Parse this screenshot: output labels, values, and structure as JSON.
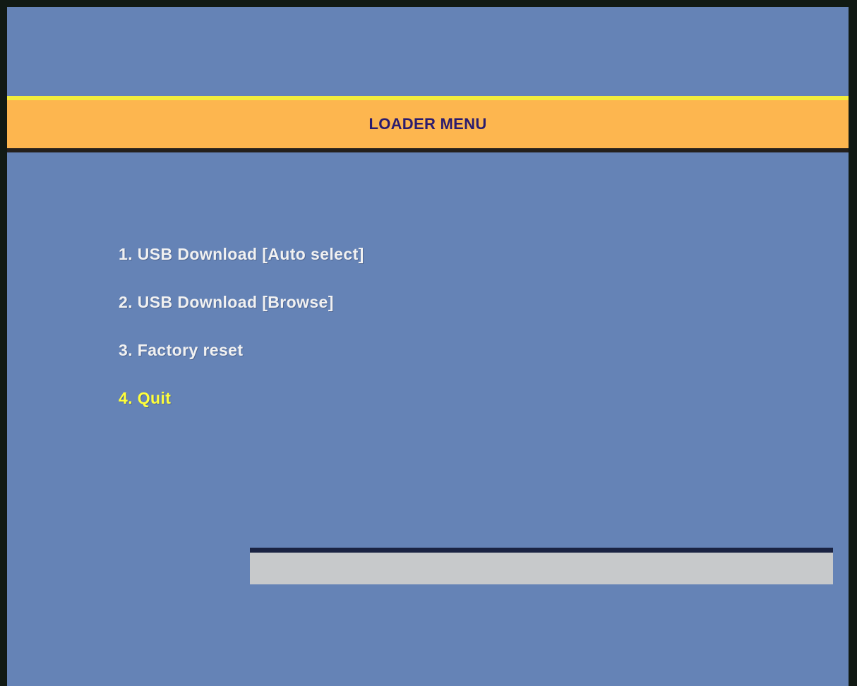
{
  "header": {
    "title": "LOADER MENU"
  },
  "menu": {
    "items": [
      {
        "label": "1. USB Download [Auto select]"
      },
      {
        "label": "2. USB Download [Browse]"
      },
      {
        "label": "3. Factory reset"
      },
      {
        "label": "4. Quit"
      }
    ],
    "selected_index": 3
  },
  "progress": {
    "value_percent": 0
  },
  "colors": {
    "background": "#6583b6",
    "title_bar": "#fdb64f",
    "title_text": "#2b1c6e",
    "menu_text": "#f1f1f1",
    "menu_selected": "#ffff3a",
    "progress_track": "#c7c9cb"
  }
}
